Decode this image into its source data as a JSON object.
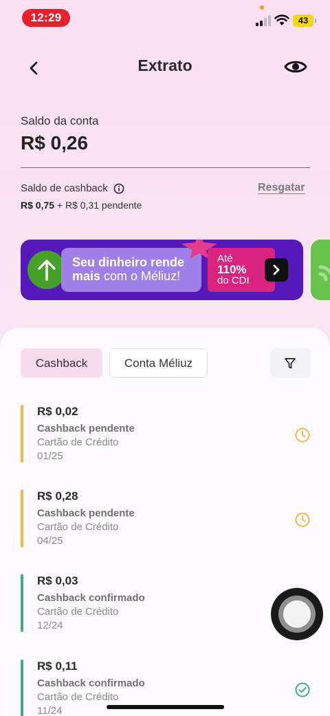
{
  "status_bar": {
    "time": "12:29",
    "battery": "43"
  },
  "header": {
    "title": "Extrato"
  },
  "balance": {
    "label": "Saldo da conta",
    "value": "R$ 0,26"
  },
  "cashback": {
    "label": "Saldo de cashback",
    "amount": "R$ 0,75",
    "pending": " + R$ 0,31 pendente",
    "redeem_label": "Resgatar"
  },
  "banner": {
    "line1": "Seu dinheiro rende",
    "line2_bold": "mais",
    "line2_rest": " com o Méliuz!",
    "cdi_pre": "Até",
    "cdi_pct": "110%",
    "cdi_post": "do CDI"
  },
  "tabs": [
    {
      "label": "Cashback",
      "active": true
    },
    {
      "label": "Conta Méliuz",
      "active": false
    }
  ],
  "transactions": [
    {
      "amount": "R$ 0,02",
      "status": "Cashback pendente",
      "method": "Cartão de Crédito",
      "date": "01/25",
      "state": "pending"
    },
    {
      "amount": "R$ 0,28",
      "status": "Cashback pendente",
      "method": "Cartão de Crédito",
      "date": "04/25",
      "state": "pending"
    },
    {
      "amount": "R$ 0,03",
      "status": "Cashback confirmado",
      "method": "Cartão de Crédito",
      "date": "12/24",
      "state": "confirmed"
    },
    {
      "amount": "R$ 0,11",
      "status": "Cashback confirmado",
      "method": "Cartão de Crédito",
      "date": "11/24",
      "state": "confirmed"
    }
  ],
  "colors": {
    "pending": "#f2b84b",
    "confirmed": "#3fae84",
    "accent_pink": "#f7dcee",
    "banner_purple": "#5419b8"
  },
  "icons": {
    "back": "chevron-left-icon",
    "eye": "eye-icon",
    "info": "info-icon",
    "filter": "filter-icon",
    "pending": "clock-icon",
    "confirmed": "check-circle-icon"
  }
}
